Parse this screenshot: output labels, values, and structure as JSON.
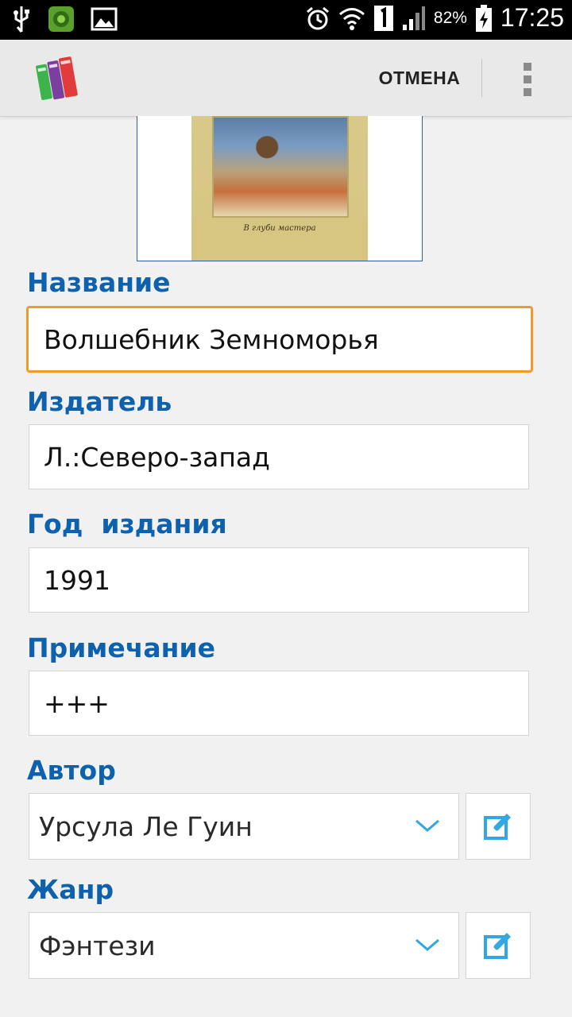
{
  "status_bar": {
    "icons_left": [
      "usb-icon",
      "app-notification-icon",
      "image-notification-icon"
    ],
    "icons_right": [
      "alarm-icon",
      "wifi-icon",
      "sim-1-icon",
      "signal-icon",
      "battery-charging-icon"
    ],
    "battery_percent": "82%",
    "time": "17:25"
  },
  "action_bar": {
    "logo_icon": "books-logo-icon",
    "cancel_label": "ОТМЕНА",
    "overflow_icon": "overflow-menu-icon"
  },
  "cover": {
    "caption": "В глуби мастера"
  },
  "form": {
    "title": {
      "label": "Название",
      "value": "Волшебник Земноморья"
    },
    "publisher": {
      "label": "Издатель",
      "value": "Л.:Северо-запад"
    },
    "year": {
      "label": "Год  издания",
      "value": "1991"
    },
    "note": {
      "label": "Примечание",
      "value": "+++"
    },
    "author": {
      "label": "Автор",
      "value": "Урсула Ле Гуин"
    },
    "genre": {
      "label": "Жанр",
      "value": "Фэнтези"
    }
  },
  "colors": {
    "label": "#0e61ad",
    "focus_border": "#f39a2b",
    "accent_icon": "#33a7e0"
  }
}
